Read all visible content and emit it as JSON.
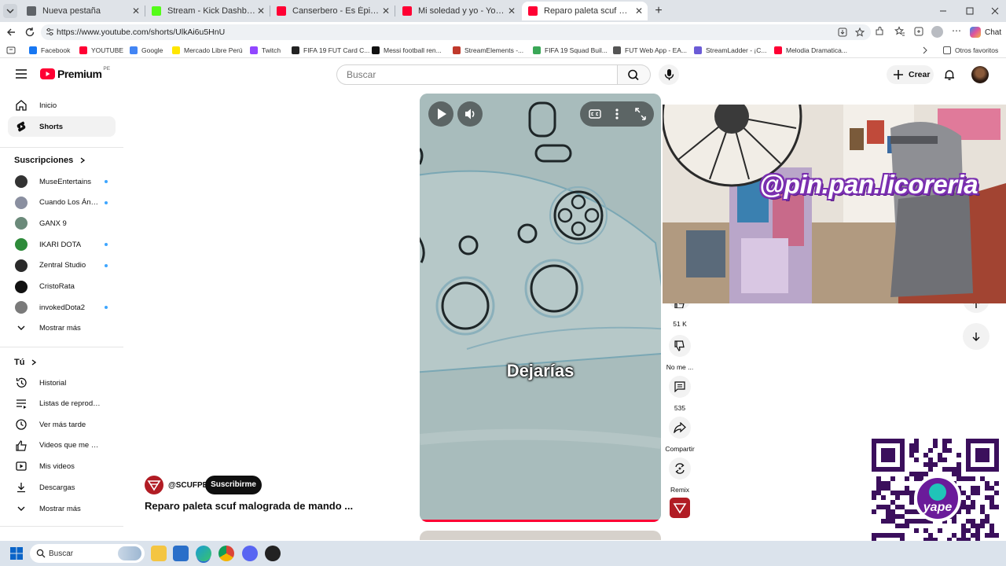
{
  "browser": {
    "tabs": [
      {
        "title": "Nueva pestaña",
        "favicon_color": "#5f6368"
      },
      {
        "title": "Stream - Kick Dashboard",
        "favicon_color": "#53fc18"
      },
      {
        "title": "Canserbero - Es Épico [Video Oficial]",
        "favicon_color": "#ff0033"
      },
      {
        "title": "Mi soledad y yo - YouTube",
        "favicon_color": "#ff0033"
      },
      {
        "title": "Reparo paleta scuf malograda de",
        "favicon_color": "#ff0033"
      }
    ],
    "url": "https://www.youtube.com/shorts/UlkAi6u5HnU",
    "chat_label": "Chat",
    "bookmarks": [
      {
        "label": "Facebook",
        "color": "#1877f2"
      },
      {
        "label": "YOUTUBE",
        "color": "#ff0033"
      },
      {
        "label": "Google",
        "color": "#4285f4"
      },
      {
        "label": "Mercado Libre Perú",
        "color": "#ffe600"
      },
      {
        "label": "Twitch",
        "color": "#9146ff"
      },
      {
        "label": "FIFA 19 FUT Card C...",
        "color": "#222222"
      },
      {
        "label": "Messi football ren...",
        "color": "#111111"
      },
      {
        "label": "StreamElements -...",
        "color": "#c0392b"
      },
      {
        "label": "FIFA 19 Squad Buil...",
        "color": "#3aa757"
      },
      {
        "label": "FUT Web App - EA...",
        "color": "#555555"
      },
      {
        "label": "StreamLadder - ¡C...",
        "color": "#6b5bd6"
      },
      {
        "label": "Melodia Dramatica...",
        "color": "#ff0033"
      }
    ],
    "other_bookmarks": "Otros favoritos"
  },
  "header": {
    "logo": "Premium",
    "region": "PE",
    "search_placeholder": "Buscar",
    "create_label": "Crear"
  },
  "sidebar": {
    "main": [
      {
        "label": "Inicio",
        "icon": "home-icon"
      },
      {
        "label": "Shorts",
        "icon": "shorts-icon",
        "active": true
      }
    ],
    "subs_title": "Suscripciones",
    "subscriptions": [
      {
        "label": "MuseEntertains",
        "color": "#333333",
        "dot": true
      },
      {
        "label": "Cuando Los Ángeles...",
        "color": "#8a8fa0",
        "dot": true
      },
      {
        "label": "GANX 9",
        "color": "#6b8a7a",
        "dot": false
      },
      {
        "label": "IKARI DOTA",
        "color": "#2e8b3a",
        "dot": true
      },
      {
        "label": "Zentral Studio",
        "color": "#2a2a2a",
        "dot": true
      },
      {
        "label": "CristoRata",
        "color": "#111111",
        "dot": false
      },
      {
        "label": "invokedDota2",
        "color": "#7a7a7a",
        "dot": true
      }
    ],
    "show_more_1": "Mostrar más",
    "you_title": "Tú",
    "you_items": [
      {
        "label": "Historial",
        "icon": "history-icon"
      },
      {
        "label": "Listas de reproducción",
        "icon": "playlists-icon"
      },
      {
        "label": "Ver más tarde",
        "icon": "watch-later-icon"
      },
      {
        "label": "Videos que me gustan",
        "icon": "liked-icon"
      },
      {
        "label": "Mis videos",
        "icon": "my-videos-icon"
      },
      {
        "label": "Descargas",
        "icon": "downloads-icon"
      }
    ],
    "show_more_2": "Mostrar más"
  },
  "short": {
    "caption": "Dejarías",
    "channel": "@SCUFPE",
    "subscribe_label": "Suscribirme",
    "title": "Reparo paleta scuf malograda de mando ...",
    "progress": 1.0
  },
  "actions": {
    "likes": "51 K",
    "dislike": "No me ...",
    "comments": "535",
    "share": "Compartir",
    "remix": "Remix"
  },
  "overlay": {
    "stream_handle": "@pin.pan.licoreria",
    "qr_brand": "yape"
  },
  "taskbar": {
    "search_placeholder": "Buscar"
  }
}
